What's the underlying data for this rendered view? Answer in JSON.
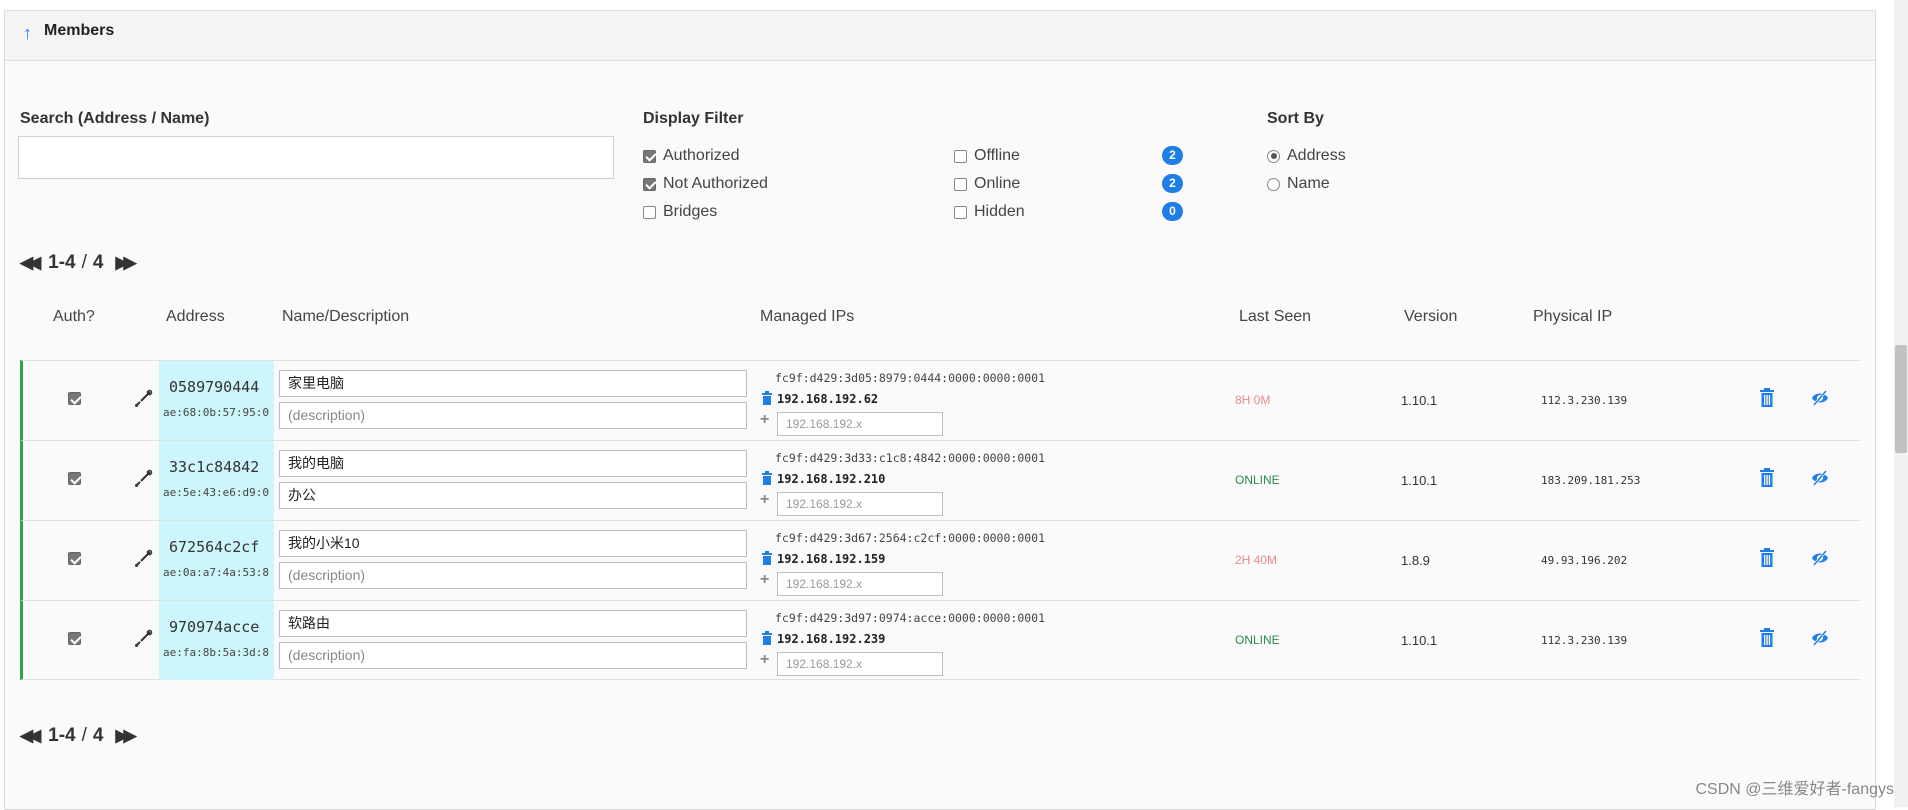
{
  "header": {
    "title": "Members"
  },
  "search": {
    "label": "Search (Address / Name)",
    "value": ""
  },
  "display_filter": {
    "label": "Display Filter",
    "options": [
      {
        "label": "Authorized",
        "checked": true
      },
      {
        "label": "Not Authorized",
        "checked": true
      },
      {
        "label": "Bridges",
        "checked": false
      },
      {
        "label": "Offline",
        "checked": false,
        "count": "2"
      },
      {
        "label": "Online",
        "checked": false,
        "count": "2"
      },
      {
        "label": "Hidden",
        "checked": false,
        "count": "0"
      }
    ]
  },
  "sort_by": {
    "label": "Sort By",
    "options": [
      {
        "label": "Address",
        "selected": true
      },
      {
        "label": "Name",
        "selected": false
      }
    ]
  },
  "pagination": {
    "range": "1-4",
    "separator": "/",
    "total": "4"
  },
  "columns": {
    "auth": "Auth?",
    "address": "Address",
    "name": "Name/Description",
    "ips": "Managed IPs",
    "last_seen": "Last Seen",
    "version": "Version",
    "physical_ip": "Physical IP"
  },
  "ip_placeholder": "192.168.192.x",
  "desc_placeholder": "(description)",
  "members": [
    {
      "authorized": true,
      "id": "0589790444",
      "mac": "ae:68:0b:57:95:0",
      "name": "家里电脑",
      "description": "",
      "ipv6": "fc9f:d429:3d05:8979:0444:0000:0000:0001",
      "ipv4": "192.168.192.62",
      "last_seen": "8H 0M",
      "status": "offline",
      "version": "1.10.1",
      "physical_ip": "112.3.230.139"
    },
    {
      "authorized": true,
      "id": "33c1c84842",
      "mac": "ae:5e:43:e6:d9:0",
      "name": "我的电脑",
      "description": "办公",
      "ipv6": "fc9f:d429:3d33:c1c8:4842:0000:0000:0001",
      "ipv4": "192.168.192.210",
      "last_seen": "ONLINE",
      "status": "online",
      "version": "1.10.1",
      "physical_ip": "183.209.181.253"
    },
    {
      "authorized": true,
      "id": "672564c2cf",
      "mac": "ae:0a:a7:4a:53:8",
      "name": "我的小米10",
      "description": "",
      "ipv6": "fc9f:d429:3d67:2564:c2cf:0000:0000:0001",
      "ipv4": "192.168.192.159",
      "last_seen": "2H 40M",
      "status": "offline",
      "version": "1.8.9",
      "physical_ip": "49.93.196.202"
    },
    {
      "authorized": true,
      "id": "970974acce",
      "mac": "ae:fa:8b:5a:3d:8",
      "name": "软路由",
      "description": "",
      "ipv6": "fc9f:d429:3d97:0974:acce:0000:0000:0001",
      "ipv4": "192.168.192.239",
      "last_seen": "ONLINE",
      "status": "online",
      "version": "1.10.1",
      "physical_ip": "112.3.230.139"
    }
  ],
  "colors": {
    "accent": "#1e7ee6",
    "online": "#2a8a4a",
    "offline": "#e88a8a",
    "address_bg": "#ccf6fb",
    "row_border": "#2aa845"
  },
  "watermark": "CSDN @三维爱好者-fangys"
}
